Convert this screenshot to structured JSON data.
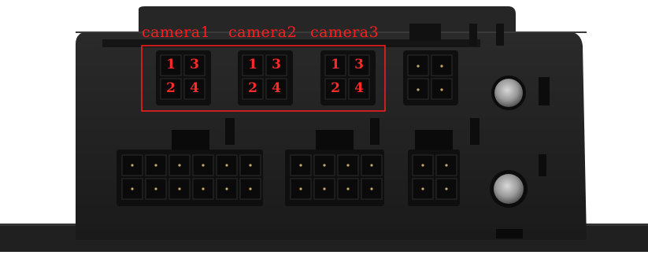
{
  "labels": {
    "camera1": "camera1",
    "camera2": "camera2",
    "camera3": "camera3"
  },
  "pin_numbers": [
    "1",
    "3",
    "2",
    "4"
  ],
  "colors": {
    "annotation": "#ff1e1e",
    "housing": "#1f1f1f",
    "housing_dark": "#0e0e0e",
    "connector_pin": "#c8a86a"
  }
}
